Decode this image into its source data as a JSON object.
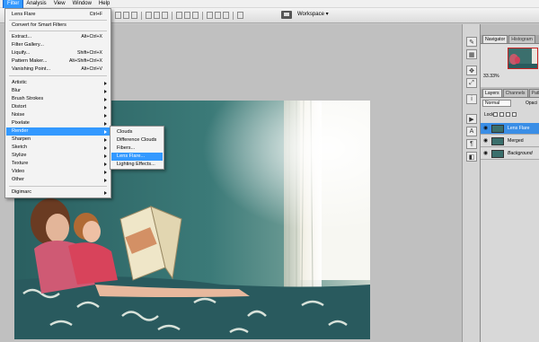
{
  "menubar": {
    "items": [
      "Filter",
      "Analysis",
      "View",
      "Window",
      "Help"
    ],
    "active_index": 0
  },
  "options_bar": {
    "workspace_label": "Workspace"
  },
  "filter_menu": {
    "last_filter": {
      "label": "Lens Flare",
      "shortcut": "Ctrl+F"
    },
    "convert": "Convert for Smart Filters",
    "commands": [
      {
        "label": "Extract...",
        "shortcut": "Alt+Ctrl+X"
      },
      {
        "label": "Filter Gallery...",
        "shortcut": ""
      },
      {
        "label": "Liquify...",
        "shortcut": "Shift+Ctrl+X"
      },
      {
        "label": "Pattern Maker...",
        "shortcut": "Alt+Shift+Ctrl+X"
      },
      {
        "label": "Vanishing Point...",
        "shortcut": "Alt+Ctrl+V"
      }
    ],
    "categories": [
      "Artistic",
      "Blur",
      "Brush Strokes",
      "Distort",
      "Noise",
      "Pixelate",
      "Render",
      "Sharpen",
      "Sketch",
      "Stylize",
      "Texture",
      "Video",
      "Other"
    ],
    "highlighted_category": "Render",
    "digimarc": "Digimarc"
  },
  "render_submenu": {
    "items": [
      "Clouds",
      "Difference Clouds",
      "Fibers...",
      "Lens Flare...",
      "Lighting Effects..."
    ],
    "highlighted": "Lens Flare..."
  },
  "panels": {
    "top_tabs": [
      "Navigator",
      "Histogram"
    ],
    "zoom": "33.33%",
    "layer_tabs": [
      "Layers",
      "Channels",
      "Paths"
    ],
    "blend_mode": "Normal",
    "opacity_label": "Opaci",
    "lock_label": "Lock:",
    "layers": [
      {
        "name": "Lens Flare",
        "selected": true,
        "italic": false
      },
      {
        "name": "Merged",
        "selected": false,
        "italic": false
      },
      {
        "name": "Background",
        "selected": false,
        "italic": true
      }
    ]
  },
  "colors": {
    "menu_highlight": "#3399ff",
    "selected_layer": "#3a8ee6",
    "photo_wall": "#2f6c6b"
  }
}
